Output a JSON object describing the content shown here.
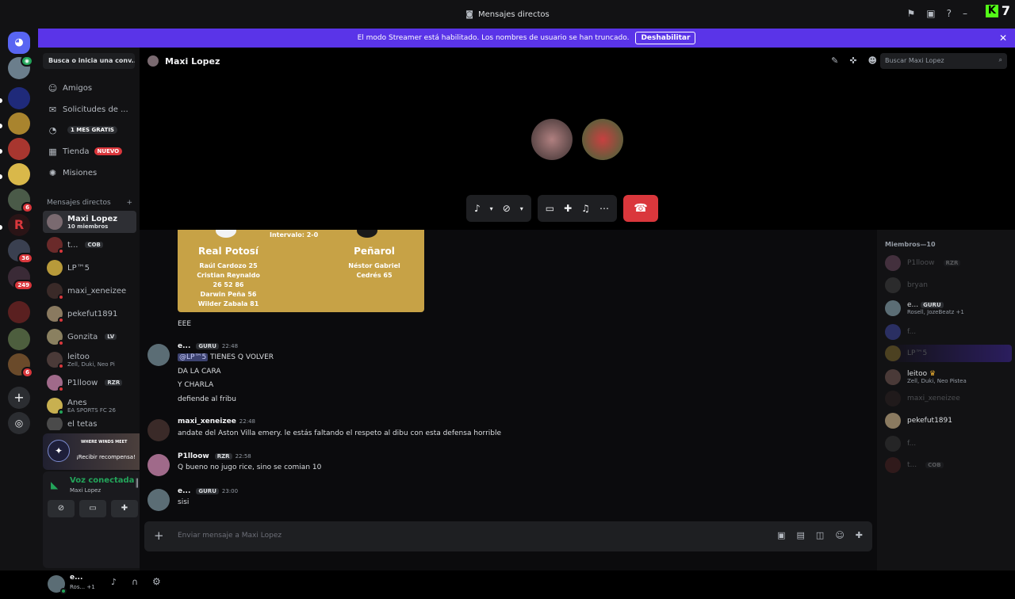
{
  "window": {
    "title": "Mensajes directos",
    "overlay_brand": "7"
  },
  "streamer_banner": {
    "text": "El modo Streamer está habilitado. Los nombres de usuario se han truncado.",
    "button": "Deshabilitar"
  },
  "servers": {
    "badges": [
      "6",
      "36",
      "249",
      "6"
    ]
  },
  "dm_sidebar": {
    "search_label": "Busca o inicia una conv...",
    "nav": [
      {
        "label": "Amigos"
      },
      {
        "label": "Solicitudes de ..."
      },
      {
        "label": "",
        "tag": "1 MES GRATIS"
      },
      {
        "label": "Tienda",
        "tag": "NUEVO"
      },
      {
        "label": "Misiones"
      }
    ],
    "section_title": "Mensajes directos",
    "dms": [
      {
        "name": "Maxi Lopez",
        "sub": "10 miembros"
      },
      {
        "name": "t...",
        "tag": "COB"
      },
      {
        "name": "LP™5"
      },
      {
        "name": "maxi_xeneizee"
      },
      {
        "name": "pekefut1891"
      },
      {
        "name": "Gonzita",
        "tag": "LV"
      },
      {
        "name": "leitoo",
        "sub": "Zell, Duki, Neo Pi"
      },
      {
        "name": "P1lloow",
        "tag": "RZR"
      },
      {
        "name": "Anes",
        "sub": "EA SPORTS FC 26"
      },
      {
        "name": "el tetas"
      }
    ],
    "promo": {
      "game": "WHERE WINDS MEET",
      "text": "¡Recibir recompensa!"
    },
    "voice": {
      "status": "Voz conectada",
      "channel": "Maxi Lopez"
    },
    "user": {
      "name": "e...",
      "sub": "Ros... +1"
    }
  },
  "header": {
    "channel": "Maxi Lopez",
    "search_placeholder": "Buscar Maxi Lopez"
  },
  "scoreboard": {
    "interval": "Intervalo: 2-0",
    "home": {
      "team": "Real Potosí",
      "scorers": [
        "Raúl Cardozo 25",
        "Cristian Reynaldo",
        "26 52 86",
        "Darwin Peña 56",
        "Wilder Zabala 81"
      ]
    },
    "away": {
      "team": "Peñarol",
      "scorers": [
        "Néstor Gabriel",
        "Cedrés 65"
      ]
    }
  },
  "messages": [
    {
      "text": "EEE"
    },
    {
      "author": "e...",
      "tag": "GURU",
      "time": "22:48",
      "mention": "@LP™5",
      "lines": [
        "TIENES Q VOLVER",
        "DA LA CARA",
        "Y CHARLA",
        "defiende al fribu"
      ]
    },
    {
      "author": "maxi_xeneizee",
      "time": "22:48",
      "lines": [
        "andate del Aston Villa emery. le estás faltando el respeto al dibu con esta defensa horrible"
      ]
    },
    {
      "author": "P1lloow",
      "tag": "RZR",
      "time": "22:58",
      "lines": [
        "Q bueno no jugo rice, sino se comian 10"
      ]
    },
    {
      "author": "e...",
      "tag": "GURU",
      "time": "23:00",
      "lines": [
        "sisi"
      ]
    }
  ],
  "composer": {
    "placeholder": "Enviar mensaje a Maxi Lopez"
  },
  "members": {
    "title": "Miembros—10",
    "list": [
      {
        "name": "P1lloow",
        "tag": "RZR",
        "dim": true
      },
      {
        "name": "bryan",
        "dim": true
      },
      {
        "name": "e...",
        "tag": "GURU",
        "sub": "Rosell, JozeBeatz +1",
        "dim": false
      },
      {
        "name": "f...",
        "dim": true
      },
      {
        "name": "LP™5",
        "dim": true
      },
      {
        "name": "leitoo",
        "sub": "Zell, Duki, Neo Pistea",
        "dim": false
      },
      {
        "name": "maxi_xeneizee",
        "dim": true
      },
      {
        "name": "pekefut1891",
        "dim": false
      },
      {
        "name": "f...",
        "dim": true
      },
      {
        "name": "t...",
        "tag": "COB",
        "dim": true
      }
    ]
  },
  "colors": {
    "accent": "#5a34e8",
    "danger": "#da373c",
    "online": "#23a55a",
    "scoreboard": "#c7a246"
  }
}
